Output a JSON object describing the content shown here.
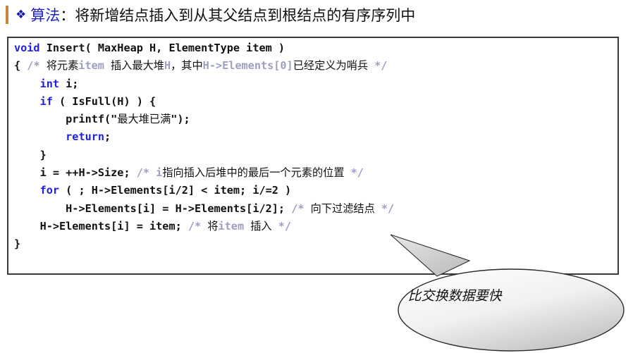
{
  "slide": {
    "heading": {
      "bullet": "❖",
      "keyword": "算法",
      "separator": "：",
      "rest": "将新增结点插入到从其父结点到根结点的有序序列中",
      "keyword_color": "#1f1fc0",
      "bar_color": "#c08a2e"
    },
    "code": {
      "language": "c",
      "keyword_color": "#1f1fe0",
      "comment_color": "#9e9ec4",
      "border_color": "#3a3a3a",
      "lines": [
        {
          "indent": 0,
          "parts": [
            {
              "text": "void",
              "kind": "keyword"
            },
            {
              "text": " Insert( MaxHeap H, ElementType item )",
              "kind": "code"
            }
          ]
        },
        {
          "indent": 0,
          "parts": [
            {
              "text": "{ ",
              "kind": "code"
            },
            {
              "text": "/* 将元素item 插入最大堆H，其中H->Elements[0]已经定义为哨兵 */",
              "kind": "comment"
            }
          ]
        },
        {
          "indent": 1,
          "parts": [
            {
              "text": "int",
              "kind": "keyword"
            },
            {
              "text": " i;",
              "kind": "code"
            }
          ]
        },
        {
          "indent": 1,
          "parts": [
            {
              "text": "if",
              "kind": "keyword"
            },
            {
              "text": " ( IsFull(H) ) {",
              "kind": "code"
            }
          ]
        },
        {
          "indent": 2,
          "parts": [
            {
              "text": "printf(\"最大堆已满\");",
              "kind": "code"
            }
          ]
        },
        {
          "indent": 2,
          "parts": [
            {
              "text": "return",
              "kind": "keyword"
            },
            {
              "text": ";",
              "kind": "code"
            }
          ]
        },
        {
          "indent": 1,
          "parts": [
            {
              "text": "}",
              "kind": "code"
            }
          ]
        },
        {
          "indent": 1,
          "parts": [
            {
              "text": "i = ++H->Size; ",
              "kind": "code"
            },
            {
              "text": "/* i指向插入后堆中的最后一个元素的位置 */",
              "kind": "comment"
            }
          ]
        },
        {
          "indent": 1,
          "parts": [
            {
              "text": "for",
              "kind": "keyword"
            },
            {
              "text": " ( ; H->Elements[i/2] < item; i/=2 )",
              "kind": "code"
            }
          ]
        },
        {
          "indent": 2,
          "parts": [
            {
              "text": "H->Elements[i] = H->Elements[i/2]; ",
              "kind": "code"
            },
            {
              "text": "/* 向下过滤结点 */",
              "kind": "comment"
            }
          ]
        },
        {
          "indent": 1,
          "parts": [
            {
              "text": "H->Elements[i] = item; ",
              "kind": "code"
            },
            {
              "text": "/* 将item 插入 */",
              "kind": "comment"
            }
          ]
        },
        {
          "indent": 0,
          "parts": [
            {
              "text": "}",
              "kind": "code"
            }
          ]
        }
      ]
    },
    "callout": {
      "text": "比交换数据要快",
      "fill_light": "#ffffff",
      "fill_dark": "#c9c9c9",
      "stroke": "#2a2a2a"
    }
  }
}
